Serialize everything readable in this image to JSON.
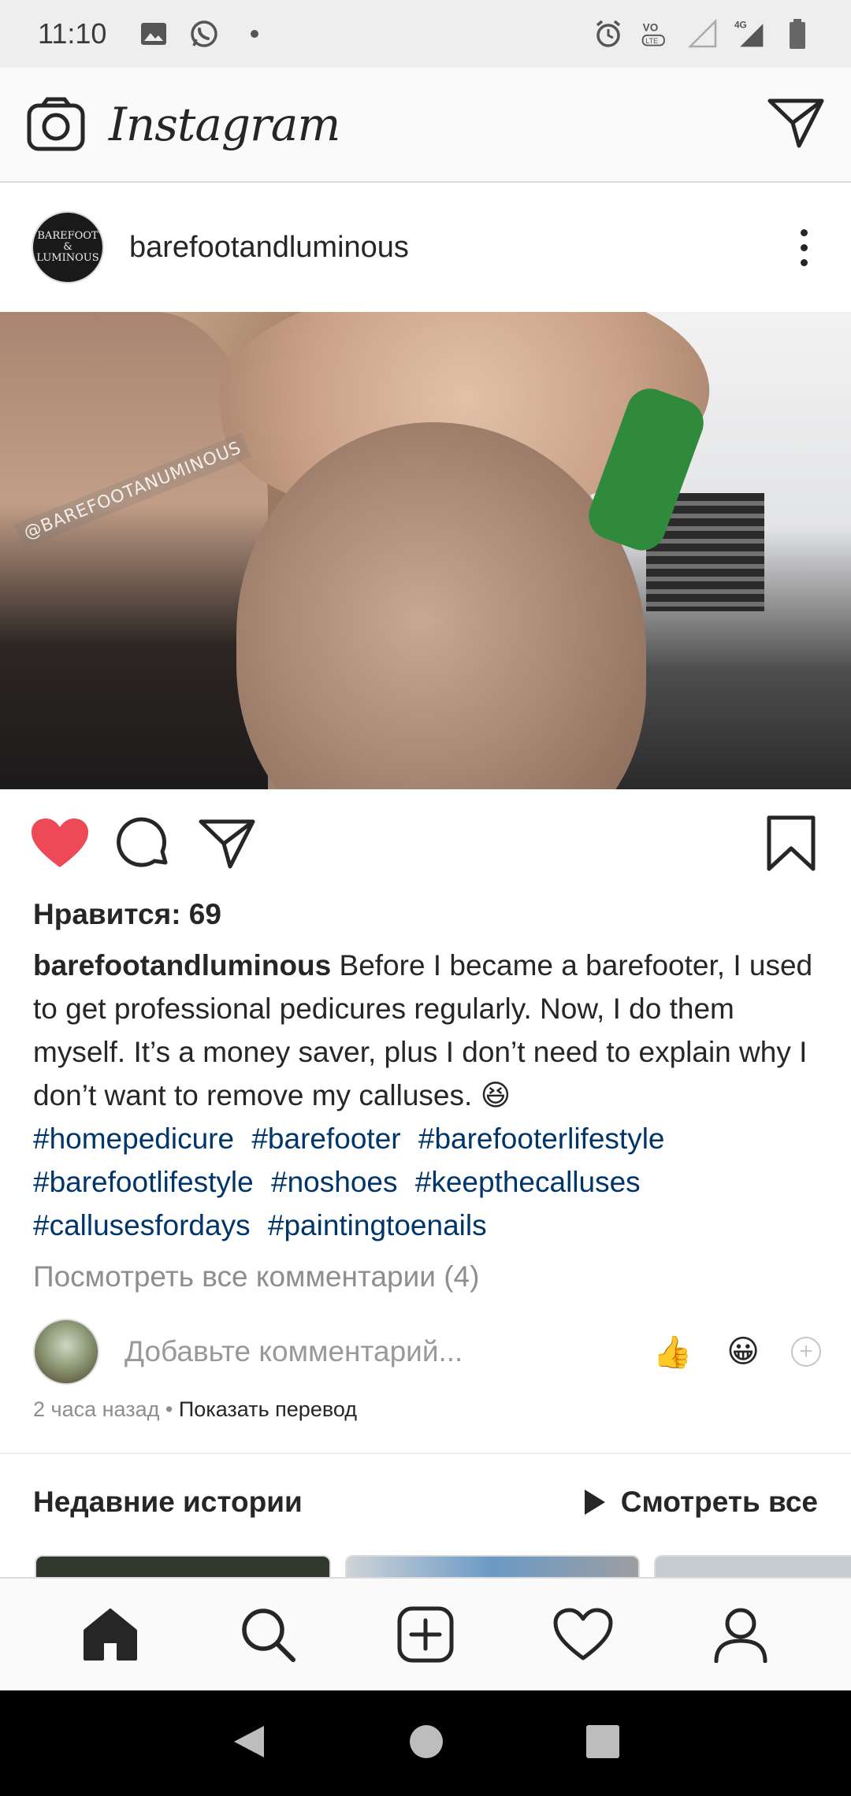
{
  "status_bar": {
    "time": "11:10",
    "left_icons": [
      "image-icon",
      "whatsapp-icon",
      "dot-icon"
    ],
    "right_icons": [
      "alarm-icon",
      "volte-icon",
      "signal-icon",
      "4g-signal-icon",
      "battery-icon"
    ],
    "network_label": "4G",
    "volte_label": "VoLTE"
  },
  "top_bar": {
    "logo": "Instagram"
  },
  "post": {
    "username": "barefootandluminous",
    "avatar_text": [
      "BAREFOOT &",
      "LUMINOUS"
    ],
    "image_watermark": "@BAREFOOTANUMINOUS",
    "likes": "Нравится: 69",
    "caption_user": "barefootandluminous",
    "caption_text": "Before I became a barefooter, I used to get professional pedicures regularly. Now, I do them myself. It’s a money saver, plus I don’t need to explain why I don’t want to remove my calluses. 😆",
    "hashtags": [
      "#homepedicure",
      "#barefooter",
      "#barefooterlifestyle",
      "#barefootlifestyle",
      "#noshoes",
      "#keepthecalluses",
      "#callusesfordays",
      "#paintingtoenails"
    ],
    "view_comments": "Посмотреть все комментарии (4)",
    "comment_placeholder": "Добавьте комментарий...",
    "quick_emojis": [
      "👍",
      "😀"
    ],
    "time_ago": "2 часа назад",
    "separator": "•",
    "translate": "Показать перевод"
  },
  "stories": {
    "title": "Недавние истории",
    "see_all": "Смотреть все"
  },
  "colors": {
    "like_red": "#ed4956",
    "hashtag_blue": "#003569",
    "muted_gray": "#8e8e8e"
  }
}
